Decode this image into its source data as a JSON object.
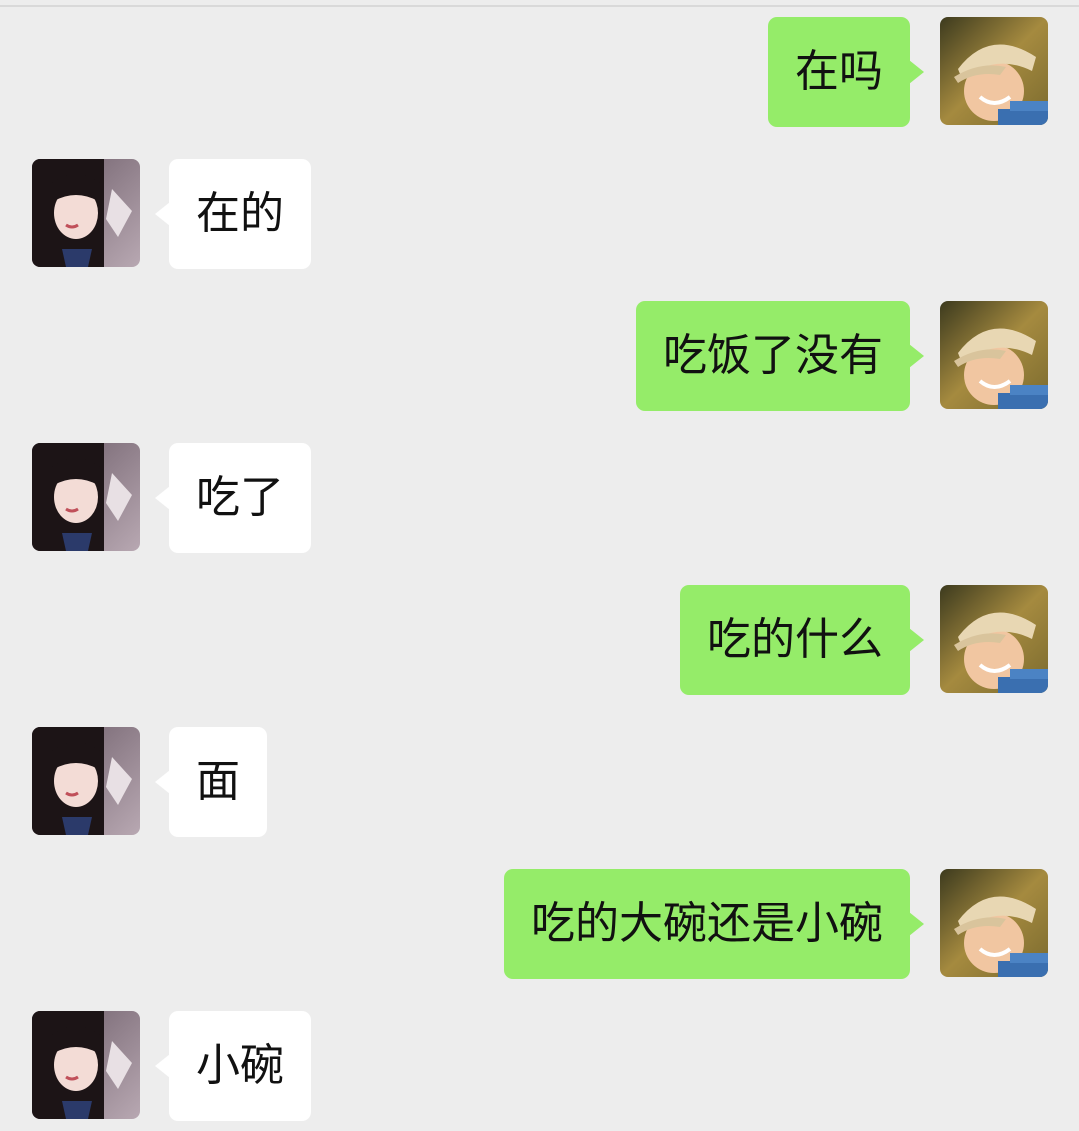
{
  "chat": {
    "messages": [
      {
        "side": "sent",
        "text": "在吗",
        "avatar": "boy-cap-avatar"
      },
      {
        "side": "recv",
        "text": "在的",
        "avatar": "anime-girl-avatar"
      },
      {
        "side": "sent",
        "text": "吃饭了没有",
        "avatar": "boy-cap-avatar"
      },
      {
        "side": "recv",
        "text": "吃了",
        "avatar": "anime-girl-avatar"
      },
      {
        "side": "sent",
        "text": "吃的什么",
        "avatar": "boy-cap-avatar"
      },
      {
        "side": "recv",
        "text": "面",
        "avatar": "anime-girl-avatar"
      },
      {
        "side": "sent",
        "text": "吃的大碗还是小碗",
        "avatar": "boy-cap-avatar"
      },
      {
        "side": "recv",
        "text": "小碗",
        "avatar": "anime-girl-avatar"
      }
    ]
  },
  "colors": {
    "background": "#ededed",
    "sent_bubble": "#95ec69",
    "recv_bubble": "#ffffff",
    "text": "#111111"
  }
}
